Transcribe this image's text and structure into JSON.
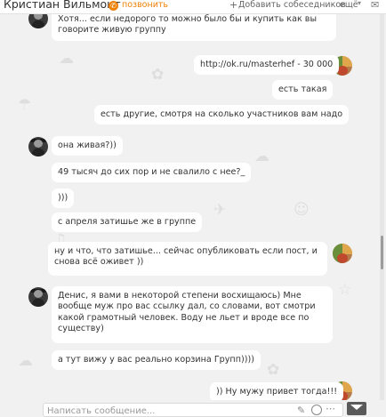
{
  "header": {
    "contact_name": "Кристиан Вильмонт",
    "call_label": "позвонить",
    "add_participants_label": "Добавить собеседников",
    "more_label": "ещё"
  },
  "messages": [
    {
      "from": "contact",
      "text": "Хотя... если недорого то можно было бы и купить как вы говорите живую группу"
    },
    {
      "from": "me",
      "text": "http://ok.ru/masterhef - 30 000"
    },
    {
      "from": "me",
      "text": "есть такая"
    },
    {
      "from": "me",
      "text": "есть другие, смотря на сколько участников вам надо"
    },
    {
      "from": "contact",
      "text": "она живая?))"
    },
    {
      "from": "contact",
      "text": "49 тысяч до сих пор и не свалило с нее?_"
    },
    {
      "from": "contact",
      "text": ")))"
    },
    {
      "from": "contact",
      "text": "с апреля затишье же в группе"
    },
    {
      "from": "me",
      "text": "ну и что, что затишье... сейчас опубликовать если пост, и снова всё оживет ))"
    },
    {
      "from": "contact",
      "text": "Денис, я вами в некоторой степени восхищаюсь) Мне вообще муж про вас ссылку дал, со словами, вот смотри какой грамотный человек. Воду не льет и вроде все по существу)"
    },
    {
      "from": "contact",
      "text": "а тут вижу у вас реально корзина Групп))))"
    },
    {
      "from": "me",
      "text": ")) Ну мужу привет тогда!!!"
    }
  ],
  "composer": {
    "placeholder": "Написать сообщение..."
  },
  "colors": {
    "accent": "#ee8208",
    "background": "#f1f1f1",
    "bubble": "#ffffff"
  },
  "icons": [
    "phone-icon",
    "add-person-icon",
    "chevron-down-icon",
    "mail-icon",
    "paperclip-icon",
    "smile-icon",
    "dots-icon",
    "send-icon"
  ]
}
